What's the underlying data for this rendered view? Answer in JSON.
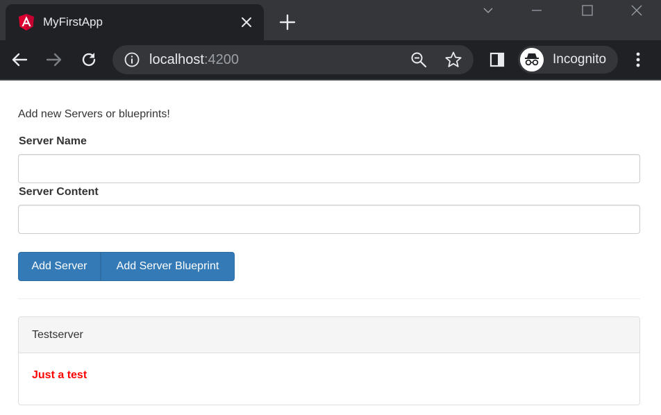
{
  "browser": {
    "tab": {
      "title": "MyFirstApp",
      "favicon": "angular-logo-icon"
    },
    "address_bar": {
      "host": "localhost",
      "port": ":4200"
    },
    "profile": {
      "label": "Incognito"
    },
    "colors": {
      "frame": "#35363a",
      "toolbar": "#202124",
      "text": "#e8eaed"
    }
  },
  "page": {
    "intro_text": "Add new Servers or blueprints!",
    "server_name": {
      "label": "Server Name",
      "value": "",
      "placeholder": ""
    },
    "server_content": {
      "label": "Server Content",
      "value": "",
      "placeholder": ""
    },
    "buttons": {
      "add_server": "Add Server",
      "add_blueprint": "Add Server Blueprint"
    },
    "server_element": {
      "name": "Testserver",
      "content": "Just a test",
      "content_color": "#ff0000"
    },
    "colors": {
      "primary_button": "#337ab7",
      "panel_heading": "#f5f5f5"
    }
  }
}
